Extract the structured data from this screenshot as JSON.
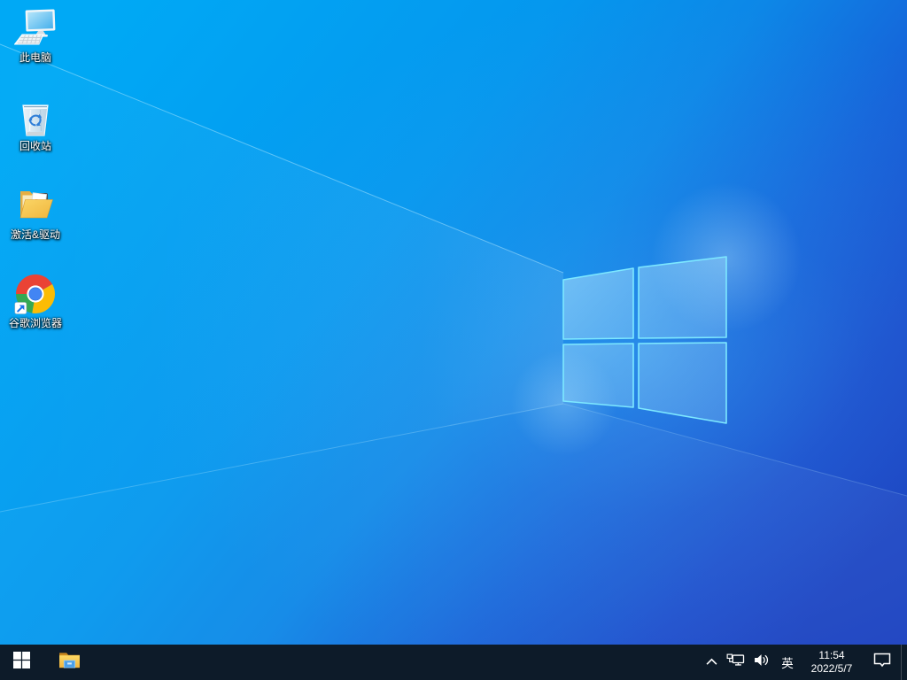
{
  "desktop": {
    "wallpaper": {
      "description": "windows-10-light-ray-default",
      "left_color": "#00a9f5",
      "right_color": "#1a3fc0",
      "logo_edge_color": "#7de8ff"
    },
    "icons": [
      {
        "id": "this-pc",
        "icon": "computer-monitor-keyboard",
        "label": "此电脑"
      },
      {
        "id": "recycle-bin",
        "icon": "recycle-bin",
        "label": "回收站"
      },
      {
        "id": "activation-drivers",
        "icon": "open-folder",
        "label": "激活&驱动"
      },
      {
        "id": "google-chrome",
        "icon": "chrome-logo-shortcut",
        "label": "谷歌浏览器"
      }
    ]
  },
  "taskbar": {
    "background_color": "#0d1b29",
    "start": {
      "icon": "windows-logo"
    },
    "pinned": [
      {
        "id": "file-explorer",
        "icon": "yellow-folder-explorer"
      }
    ],
    "tray": {
      "hidden_icons_icon": "chevron-up",
      "network_icon": "ethernet-monitor",
      "volume_icon": "speaker-waves",
      "ime_label": "英",
      "clock": {
        "time": "11:54",
        "date": "2022/5/7"
      },
      "action_center_icon": "notification-bubble"
    }
  },
  "brand_colors": {
    "chrome_red": "#ea4335",
    "chrome_yellow": "#fbbc05",
    "chrome_green": "#34a853",
    "chrome_blue": "#4285f4",
    "windows_red": "#f25022",
    "windows_green": "#7fba00",
    "windows_blue": "#00a4ef",
    "windows_yellow": "#ffb900"
  }
}
